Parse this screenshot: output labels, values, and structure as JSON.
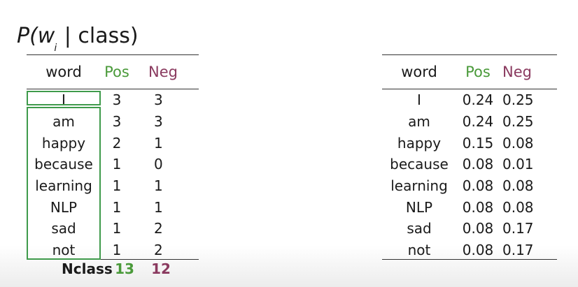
{
  "title": {
    "prefix": "P(w",
    "subscript": "i",
    "suffix": " | class)"
  },
  "left_table": {
    "headers": [
      "word",
      "Pos",
      "Neg"
    ],
    "rows": [
      [
        "I",
        "3",
        "3"
      ],
      [
        "am",
        "3",
        "3"
      ],
      [
        "happy",
        "2",
        "1"
      ],
      [
        "because",
        "1",
        "0"
      ],
      [
        "learning",
        "1",
        "1"
      ],
      [
        "NLP",
        "1",
        "1"
      ],
      [
        "sad",
        "1",
        "2"
      ],
      [
        "not",
        "1",
        "2"
      ]
    ],
    "footer": {
      "label": "Nclass",
      "pos": "13",
      "neg": "12"
    }
  },
  "right_table": {
    "headers": [
      "word",
      "Pos",
      "Neg"
    ],
    "rows": [
      [
        "I",
        "0.24",
        "0.25"
      ],
      [
        "am",
        "0.24",
        "0.25"
      ],
      [
        "happy",
        "0.15",
        "0.08"
      ],
      [
        "because",
        "0.08",
        "0.01"
      ],
      [
        "learning",
        "0.08",
        "0.08"
      ],
      [
        "NLP",
        "0.08",
        "0.08"
      ],
      [
        "sad",
        "0.08",
        "0.17"
      ],
      [
        "not",
        "0.08",
        "0.17"
      ]
    ]
  },
  "colors": {
    "pos": "#4a9a3a",
    "neg": "#8a3a5f",
    "highlight_box": "#3f9a4b"
  }
}
